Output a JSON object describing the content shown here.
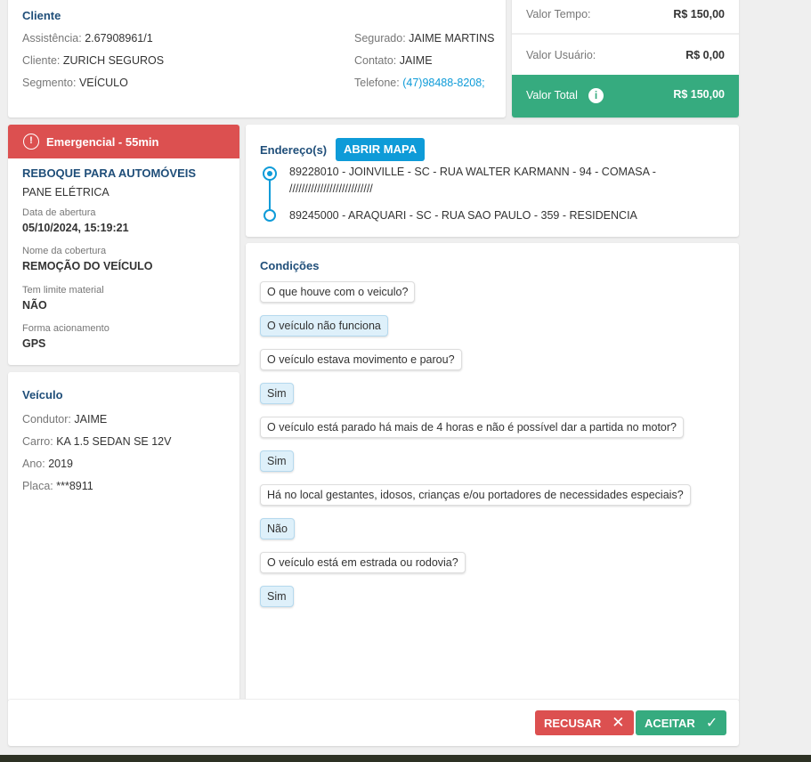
{
  "cliente": {
    "title": "Cliente",
    "assistencia_label": "Assistência:",
    "assistencia": "2.67908961/1",
    "cliente_label": "Cliente:",
    "cliente": "ZURICH SEGUROS",
    "segmento_label": "Segmento:",
    "segmento": "VEÍCULO",
    "segurado_label": "Segurado:",
    "segurado": "JAIME MARTINS",
    "contato_label": "Contato:",
    "contato": "JAIME",
    "telefone_label": "Telefone:",
    "telefone": "(47)98488-8208;"
  },
  "valores": {
    "tempo_label": "Valor Tempo:",
    "tempo": "R$ 150,00",
    "usuario_label": "Valor Usuário:",
    "usuario": "R$ 0,00",
    "total_label": "Valor Total",
    "total": "R$ 150,00"
  },
  "servico": {
    "badge": "Emergencial - 55min",
    "tipo": "REBOQUE PARA AUTOMÓVEIS",
    "motivo": "PANE ELÉTRICA",
    "abertura_label": "Data de abertura",
    "abertura": "05/10/2024, 15:19:21",
    "cobertura_label": "Nome da cobertura",
    "cobertura": "REMOÇÃO DO VEÍCULO",
    "limite_label": "Tem limite material",
    "limite": "NÃO",
    "acionamento_label": "Forma acionamento",
    "acionamento": "GPS"
  },
  "veiculo": {
    "title": "Veículo",
    "condutor_label": "Condutor:",
    "condutor": "JAIME",
    "carro_label": "Carro:",
    "carro": "KA 1.5 SEDAN SE 12V",
    "ano_label": "Ano:",
    "ano": "2019",
    "placa_label": "Placa:",
    "placa": "***8911"
  },
  "enderecos": {
    "title": "Endereço(s)",
    "map_button": "ABRIR MAPA",
    "origem": "89228010 - JOINVILLE - SC - RUA WALTER KARMANN - 94 - COMASA -",
    "origem2": "///////////////////////////",
    "destino": "89245000 - ARAQUARI - SC - RUA SAO PAULO - 359 - RESIDENCIA"
  },
  "condicoes": {
    "title": "Condições",
    "items": [
      {
        "q": "O que houve com o veiculo?",
        "a": "O veículo não funciona"
      },
      {
        "q": "O veículo estava movimento e parou?",
        "a": "Sim"
      },
      {
        "q": "O veículo está parado há mais de 4 horas e não é possível dar a partida no motor?",
        "a": "Sim"
      },
      {
        "q": "Há no local gestantes, idosos, crianças e/ou portadores de necessidades especiais?",
        "a": "Não"
      },
      {
        "q": "O veículo está em estrada ou rodovia?",
        "a": "Sim"
      }
    ]
  },
  "actions": {
    "recusar": "RECUSAR",
    "aceitar": "ACEITAR"
  },
  "colors": {
    "green": "#36ab7f",
    "red": "#dc5050",
    "blue": "#0e9bd8"
  }
}
